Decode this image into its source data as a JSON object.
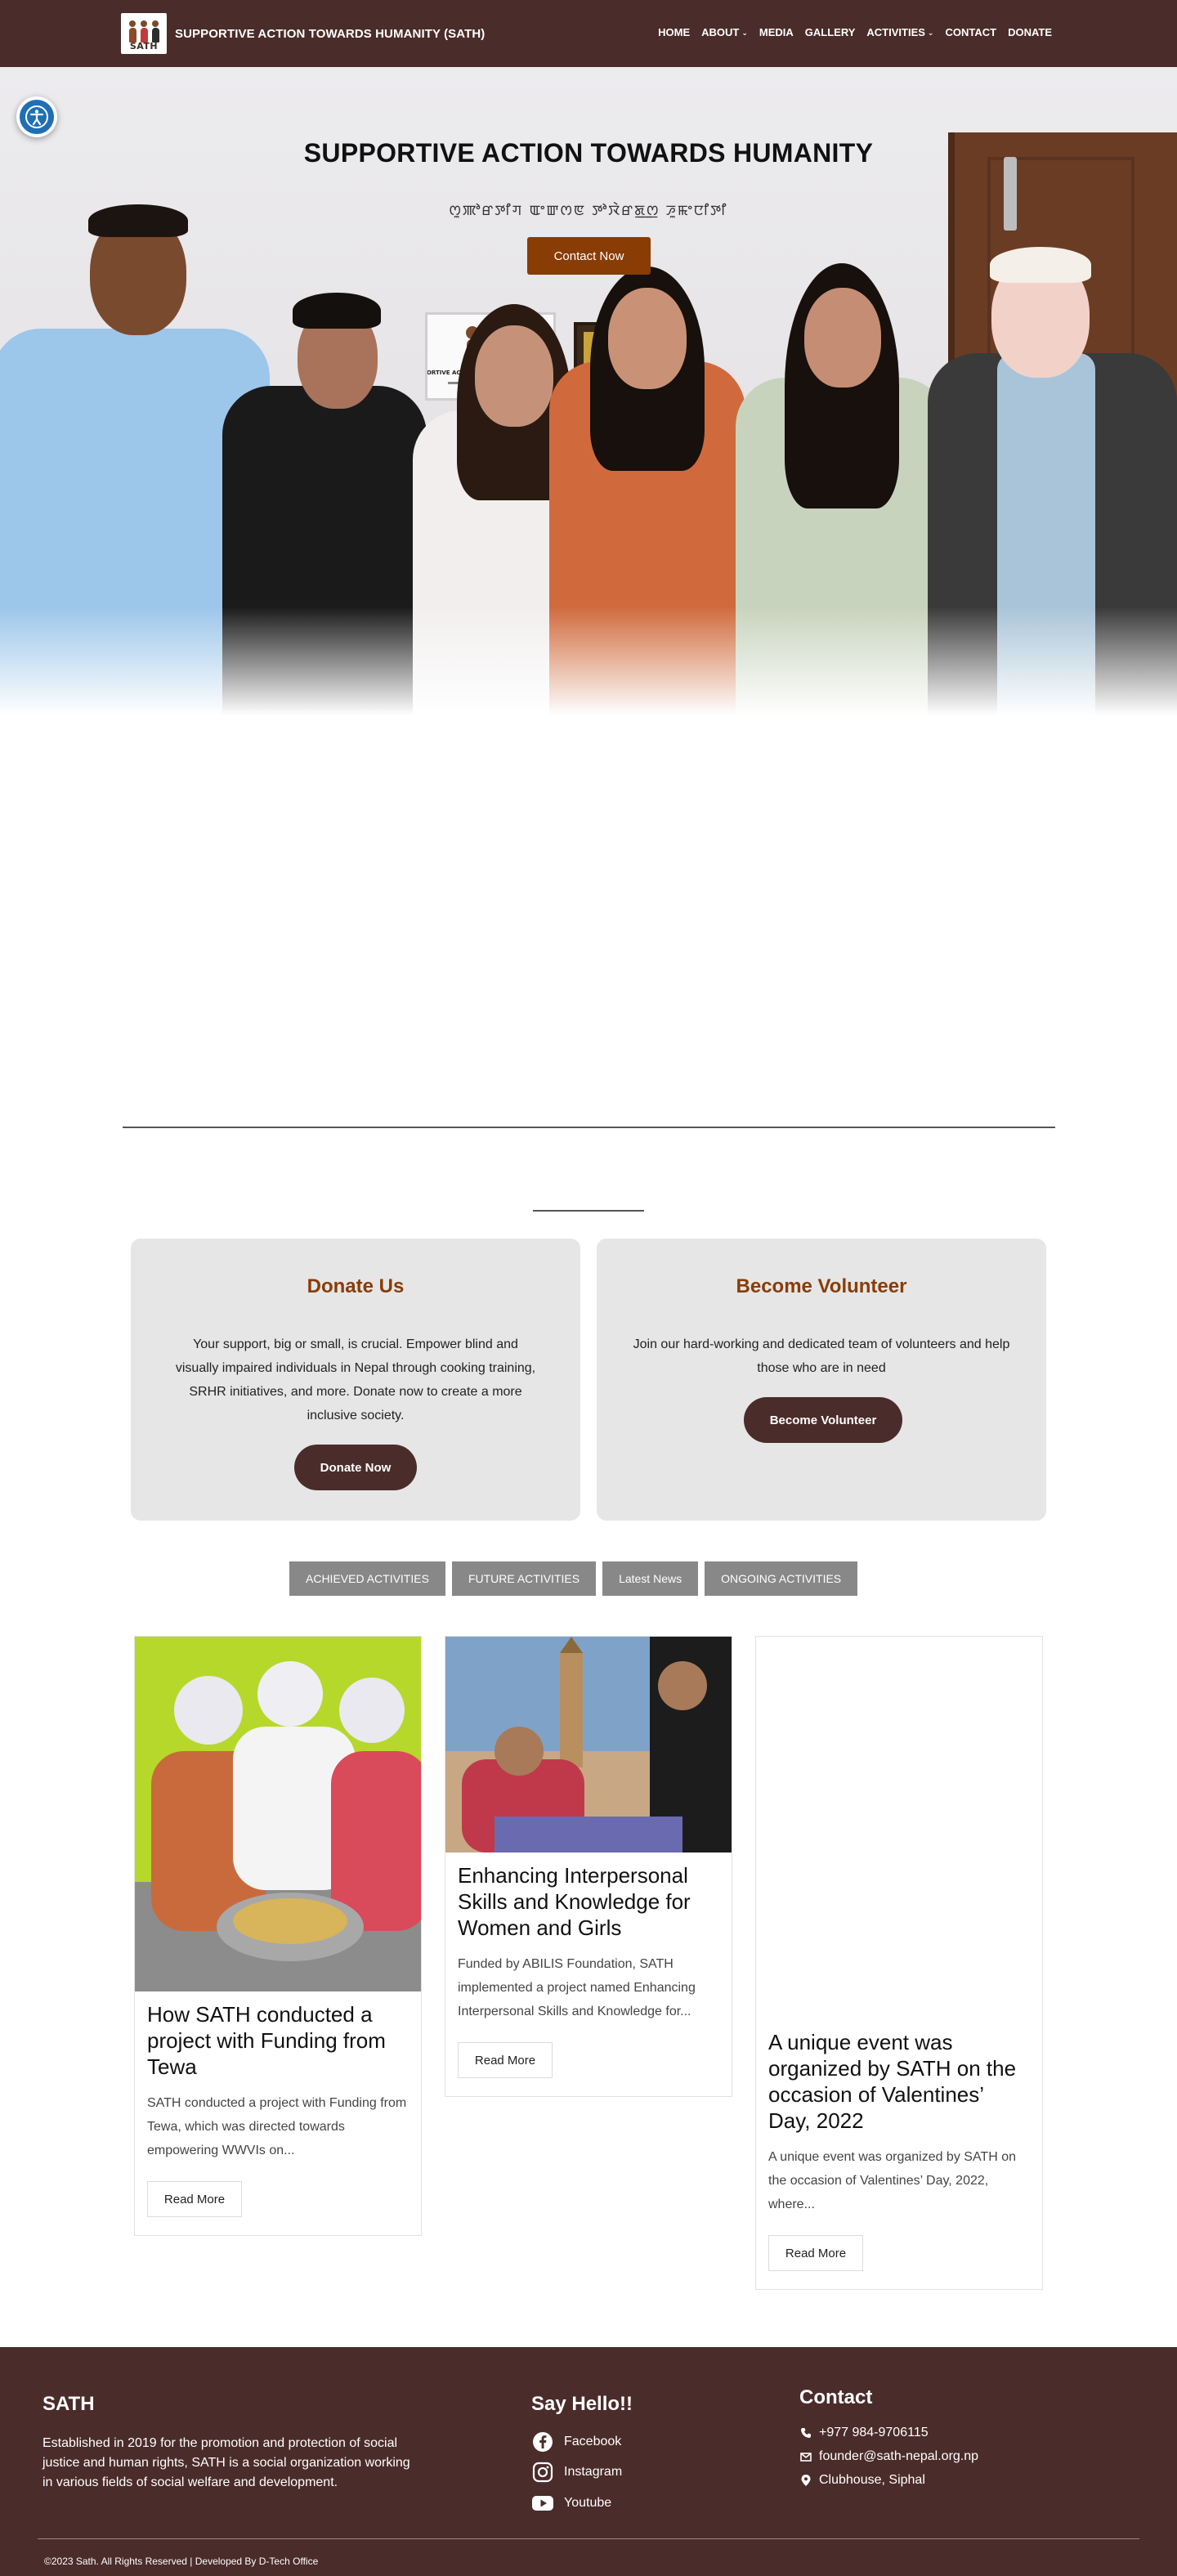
{
  "colors": {
    "brand_dark": "#4a2c2a",
    "accent_brown": "#8a3c05",
    "tab_gray": "#888888",
    "card_bg": "#e6e6e6"
  },
  "header": {
    "logo_text": "SATH",
    "site_name": "SUPPORTIVE ACTION TOWARDS HUMANITY (SATH)",
    "nav": [
      {
        "label": "HOME",
        "dropdown": false
      },
      {
        "label": "ABOUT",
        "dropdown": true
      },
      {
        "label": "MEDIA",
        "dropdown": false
      },
      {
        "label": "GALLERY",
        "dropdown": false
      },
      {
        "label": "ACTIVITIES",
        "dropdown": true
      },
      {
        "label": "CONTACT",
        "dropdown": false
      },
      {
        "label": "DONATE",
        "dropdown": false
      }
    ],
    "dropdown_icon": "chevron-down-icon"
  },
  "accessibility": {
    "icon": "accessibility-icon"
  },
  "hero": {
    "title": "SUPPORTIVE ACTION TOWARDS HUMANITY",
    "subtitle": "ꯁꯨꯄꯣꯔꯇꯤꯚ ꯑꯦꯛꯁꯟ ꯇꯣꯋꯥꯔꯗ꯭ꯁ ꯍꯨꯃꯦꯅꯤꯇꯤ",
    "cta_label": "Contact Now",
    "poster_text": "SUPPORTIVE ACTION TOWARDS HUMANITY (SATH)"
  },
  "cta_cards": {
    "donate": {
      "title": "Donate Us",
      "text": "Your support, big or small, is crucial. Empower blind and visually impaired individuals in Nepal through cooking training, SRHR initiatives, and more. Donate now to create a more inclusive society.",
      "button": "Donate Now"
    },
    "volunteer": {
      "title": "Become Volunteer",
      "text": "Join our hard-working and dedicated team of volunteers and help those who are in need",
      "button": "Become Volunteer"
    }
  },
  "tabs": [
    "ACHIEVED ACTIVITIES",
    "FUTURE ACTIVITIES",
    "Latest News",
    "ONGOING ACTIVITIES"
  ],
  "posts": [
    {
      "title": "How SATH conducted a project with Funding from Tewa",
      "excerpt": "SATH conducted a project with Funding from Tewa, which was directed towards empowering WWVIs on...",
      "button": "Read More"
    },
    {
      "title": "Enhancing Interpersonal Skills and Knowledge for Women and Girls",
      "excerpt": "Funded by ABILIS Foundation, SATH implemented a project named Enhancing Interpersonal Skills and Knowledge for...",
      "button": "Read More"
    },
    {
      "title": "A unique event was organized by SATH on the occasion of Valentines’ Day, 2022",
      "excerpt": "A unique event was organized by SATH on the occasion of Valentines’ Day, 2022, where...",
      "button": "Read More"
    }
  ],
  "footer": {
    "about_title": "SATH",
    "about_text": "Established in 2019 for the promotion and protection of social justice and human rights, SATH is a social organization working in various fields of social welfare and development.",
    "social_title": "Say Hello!!",
    "social": [
      {
        "label": "Facebook",
        "icon": "facebook-icon"
      },
      {
        "label": "Instagram",
        "icon": "instagram-icon"
      },
      {
        "label": "Youtube",
        "icon": "youtube-icon"
      }
    ],
    "contact_title": "Contact",
    "contact": [
      {
        "label": "+977 984-9706115",
        "icon": "phone-icon"
      },
      {
        "label": "founder@sath-nepal.org.np",
        "icon": "email-icon"
      },
      {
        "label": "Clubhouse, Siphal",
        "icon": "location-icon"
      }
    ],
    "copyright": "©2023 Sath. All Rights Reserved | Developed By D-Tech Office"
  }
}
